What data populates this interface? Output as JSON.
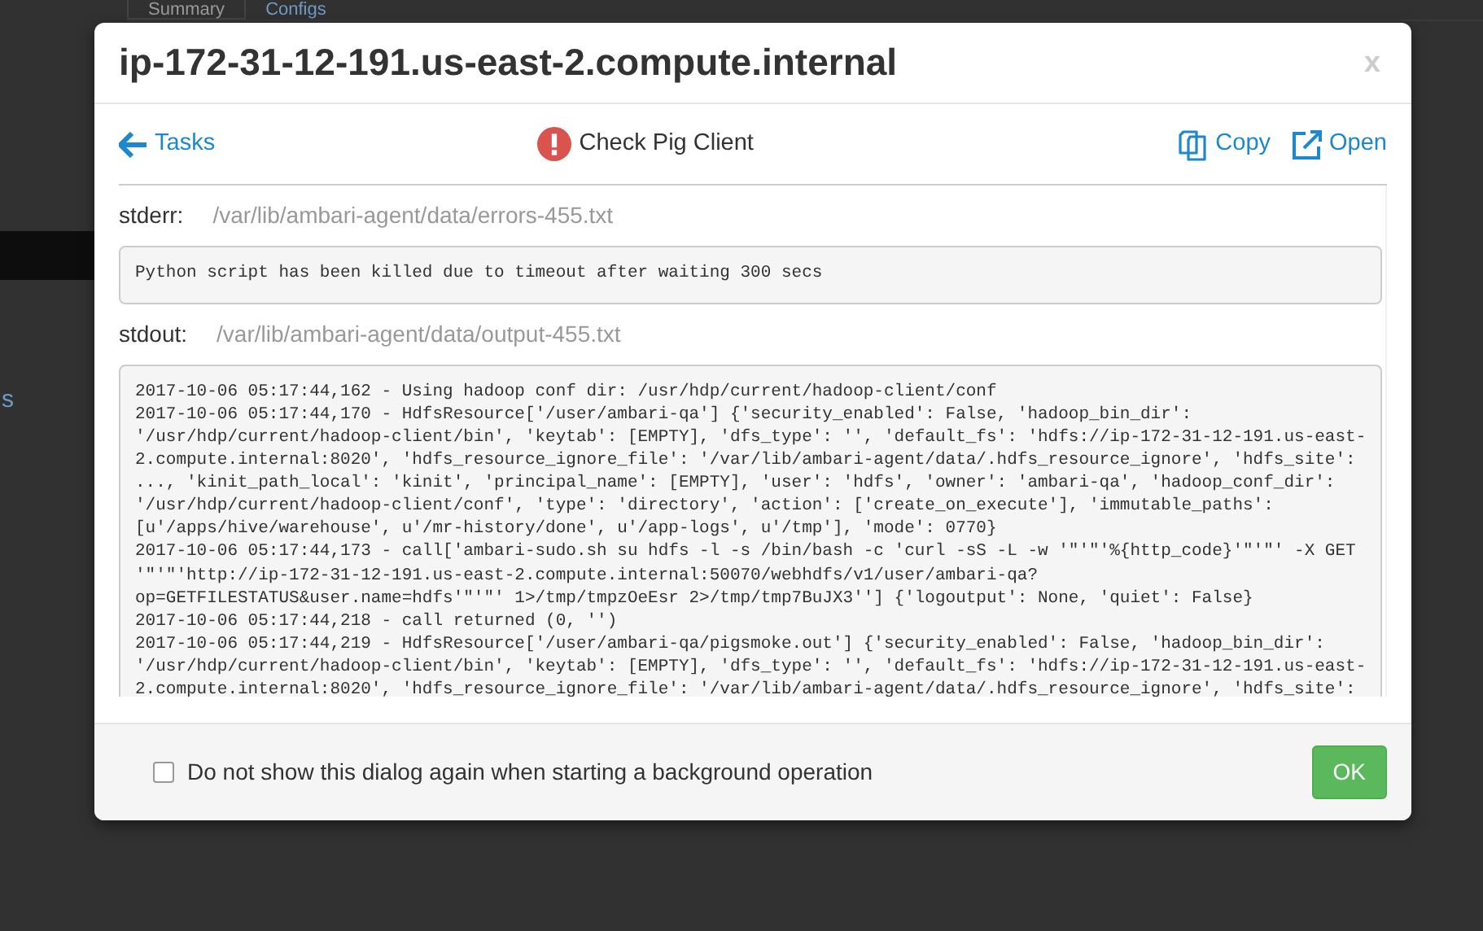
{
  "background": {
    "tabs": [
      {
        "label": "Summary",
        "selected": true
      },
      {
        "label": "Configs",
        "selected": false
      }
    ],
    "side_link": "s"
  },
  "dialog": {
    "title": "ip-172-31-12-191.us-east-2.compute.internal",
    "close": "x",
    "back_link": "Tasks",
    "task": {
      "name": "Check Pig Client",
      "failed": true
    },
    "actions": [
      {
        "kind": "copy",
        "label": "Copy"
      },
      {
        "kind": "open",
        "label": "Open"
      }
    ],
    "stderr": {
      "label": "stderr:",
      "path": "/var/lib/ambari-agent/data/errors-455.txt",
      "text": "Python script has been killed due to timeout after waiting 300 secs"
    },
    "stdout": {
      "label": "stdout:",
      "path": "/var/lib/ambari-agent/data/output-455.txt",
      "lines": [
        "2017-10-06 05:17:44,162 - Using hadoop conf dir: /usr/hdp/current/hadoop-client/conf",
        "2017-10-06 05:17:44,170 - HdfsResource['/user/ambari-qa'] {'security_enabled': False, 'hadoop_bin_dir':",
        "'/usr/hdp/current/hadoop-client/bin', 'keytab': [EMPTY], 'dfs_type': '', 'default_fs': 'hdfs://ip-172-31-12-191.us-east-",
        "2.compute.internal:8020', 'hdfs_resource_ignore_file': '/var/lib/ambari-agent/data/.hdfs_resource_ignore', 'hdfs_site':",
        "..., 'kinit_path_local': 'kinit', 'principal_name': [EMPTY], 'user': 'hdfs', 'owner': 'ambari-qa', 'hadoop_conf_dir':",
        "'/usr/hdp/current/hadoop-client/conf', 'type': 'directory', 'action': ['create_on_execute'], 'immutable_paths':",
        "[u'/apps/hive/warehouse', u'/mr-history/done', u'/app-logs', u'/tmp'], 'mode': 0770}",
        "2017-10-06 05:17:44,173 - call['ambari-sudo.sh su hdfs -l -s /bin/bash -c 'curl -sS -L -w '\"'\"'%{http_code}'\"'\"' -X GET",
        "'\"'\"'http://ip-172-31-12-191.us-east-2.compute.internal:50070/webhdfs/v1/user/ambari-qa?",
        "op=GETFILESTATUS&user.name=hdfs'\"'\"' 1>/tmp/tmpzOeEsr 2>/tmp/tmp7BuJX3''] {'logoutput': None, 'quiet': False}",
        "2017-10-06 05:17:44,218 - call returned (0, '')",
        "2017-10-06 05:17:44,219 - HdfsResource['/user/ambari-qa/pigsmoke.out'] {'security_enabled': False, 'hadoop_bin_dir':",
        "'/usr/hdp/current/hadoop-client/bin', 'keytab': [EMPTY], 'dfs_type': '', 'default_fs': 'hdfs://ip-172-31-12-191.us-east-",
        "2.compute.internal:8020', 'hdfs_resource_ignore_file': '/var/lib/ambari-agent/data/.hdfs_resource_ignore', 'hdfs_site':"
      ]
    },
    "dont_show": {
      "label": "Do not show this dialog again when starting a background operation",
      "checked": false
    },
    "ok": "OK"
  }
}
